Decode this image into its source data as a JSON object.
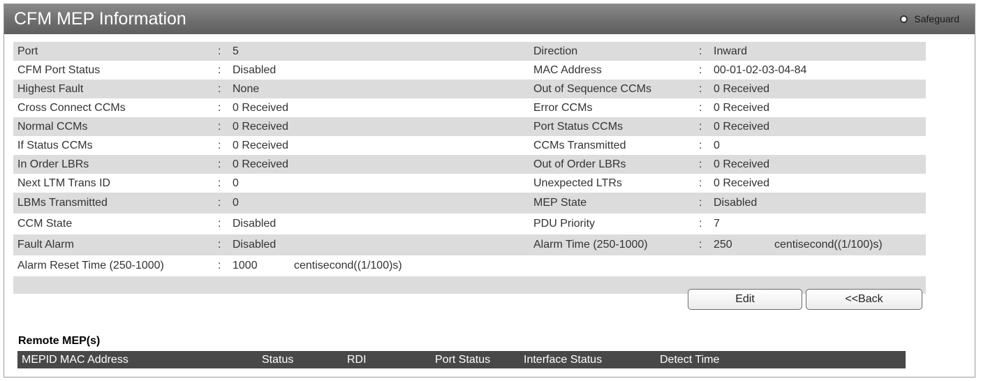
{
  "title": "CFM MEP Information",
  "safeguard_label": "Safeguard",
  "left_fields": [
    {
      "label": "Port",
      "value": "5"
    },
    {
      "label": "CFM Port Status",
      "value": "Disabled"
    },
    {
      "label": "Highest Fault",
      "value": "None"
    },
    {
      "label": "Cross Connect CCMs",
      "value": "0  Received"
    },
    {
      "label": "Normal CCMs",
      "value": "0  Received"
    },
    {
      "label": "If Status CCMs",
      "value": "0  Received"
    },
    {
      "label": "In Order LBRs",
      "value": "0  Received"
    },
    {
      "label": "Next LTM Trans ID",
      "value": "0"
    },
    {
      "label": "LBMs Transmitted",
      "value": "0"
    },
    {
      "label": "CCM State",
      "value": "Disabled"
    },
    {
      "label": "Fault Alarm",
      "value": "Disabled"
    },
    {
      "label": "Alarm Reset Time (250-1000)",
      "value": "1000",
      "unit": "centisecond((1/100)s)"
    }
  ],
  "right_fields": [
    {
      "label": "Direction",
      "value": "Inward"
    },
    {
      "label": "MAC Address",
      "value": "00-01-02-03-04-84"
    },
    {
      "label": "Out of Sequence CCMs",
      "value": "0  Received"
    },
    {
      "label": "Error CCMs",
      "value": "0  Received"
    },
    {
      "label": "Port Status CCMs",
      "value": "0  Received"
    },
    {
      "label": "CCMs Transmitted",
      "value": "0"
    },
    {
      "label": "Out of Order LBRs",
      "value": "0  Received"
    },
    {
      "label": "Unexpected LTRs",
      "value": "0  Received"
    },
    {
      "label": "MEP State",
      "value": "Disabled"
    },
    {
      "label": "PDU Priority",
      "value": "7"
    },
    {
      "label": "Alarm Time (250-1000)",
      "value": "250",
      "unit": "centisecond((1/100)s)"
    }
  ],
  "colon": ":",
  "buttons": {
    "edit": "Edit",
    "back": "<<Back"
  },
  "remote": {
    "title": "Remote MEP(s)",
    "columns": [
      "MEPID",
      "MAC Address",
      "Status",
      "RDI",
      "Port Status",
      "Interface Status",
      "Detect Time"
    ]
  }
}
